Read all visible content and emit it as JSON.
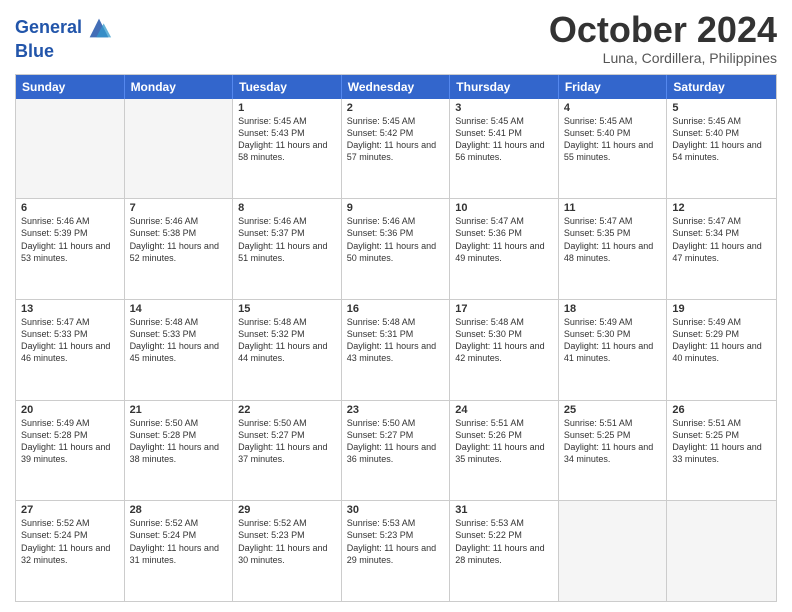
{
  "header": {
    "logo_line1": "General",
    "logo_line2": "Blue",
    "month": "October 2024",
    "location": "Luna, Cordillera, Philippines"
  },
  "days_of_week": [
    "Sunday",
    "Monday",
    "Tuesday",
    "Wednesday",
    "Thursday",
    "Friday",
    "Saturday"
  ],
  "weeks": [
    [
      {
        "day": "",
        "empty": true
      },
      {
        "day": "",
        "empty": true
      },
      {
        "day": "1",
        "sunrise": "5:45 AM",
        "sunset": "5:43 PM",
        "daylight": "11 hours and 58 minutes."
      },
      {
        "day": "2",
        "sunrise": "5:45 AM",
        "sunset": "5:42 PM",
        "daylight": "11 hours and 57 minutes."
      },
      {
        "day": "3",
        "sunrise": "5:45 AM",
        "sunset": "5:41 PM",
        "daylight": "11 hours and 56 minutes."
      },
      {
        "day": "4",
        "sunrise": "5:45 AM",
        "sunset": "5:40 PM",
        "daylight": "11 hours and 55 minutes."
      },
      {
        "day": "5",
        "sunrise": "5:45 AM",
        "sunset": "5:40 PM",
        "daylight": "11 hours and 54 minutes."
      }
    ],
    [
      {
        "day": "6",
        "sunrise": "5:46 AM",
        "sunset": "5:39 PM",
        "daylight": "11 hours and 53 minutes."
      },
      {
        "day": "7",
        "sunrise": "5:46 AM",
        "sunset": "5:38 PM",
        "daylight": "11 hours and 52 minutes."
      },
      {
        "day": "8",
        "sunrise": "5:46 AM",
        "sunset": "5:37 PM",
        "daylight": "11 hours and 51 minutes."
      },
      {
        "day": "9",
        "sunrise": "5:46 AM",
        "sunset": "5:36 PM",
        "daylight": "11 hours and 50 minutes."
      },
      {
        "day": "10",
        "sunrise": "5:47 AM",
        "sunset": "5:36 PM",
        "daylight": "11 hours and 49 minutes."
      },
      {
        "day": "11",
        "sunrise": "5:47 AM",
        "sunset": "5:35 PM",
        "daylight": "11 hours and 48 minutes."
      },
      {
        "day": "12",
        "sunrise": "5:47 AM",
        "sunset": "5:34 PM",
        "daylight": "11 hours and 47 minutes."
      }
    ],
    [
      {
        "day": "13",
        "sunrise": "5:47 AM",
        "sunset": "5:33 PM",
        "daylight": "11 hours and 46 minutes."
      },
      {
        "day": "14",
        "sunrise": "5:48 AM",
        "sunset": "5:33 PM",
        "daylight": "11 hours and 45 minutes."
      },
      {
        "day": "15",
        "sunrise": "5:48 AM",
        "sunset": "5:32 PM",
        "daylight": "11 hours and 44 minutes."
      },
      {
        "day": "16",
        "sunrise": "5:48 AM",
        "sunset": "5:31 PM",
        "daylight": "11 hours and 43 minutes."
      },
      {
        "day": "17",
        "sunrise": "5:48 AM",
        "sunset": "5:30 PM",
        "daylight": "11 hours and 42 minutes."
      },
      {
        "day": "18",
        "sunrise": "5:49 AM",
        "sunset": "5:30 PM",
        "daylight": "11 hours and 41 minutes."
      },
      {
        "day": "19",
        "sunrise": "5:49 AM",
        "sunset": "5:29 PM",
        "daylight": "11 hours and 40 minutes."
      }
    ],
    [
      {
        "day": "20",
        "sunrise": "5:49 AM",
        "sunset": "5:28 PM",
        "daylight": "11 hours and 39 minutes."
      },
      {
        "day": "21",
        "sunrise": "5:50 AM",
        "sunset": "5:28 PM",
        "daylight": "11 hours and 38 minutes."
      },
      {
        "day": "22",
        "sunrise": "5:50 AM",
        "sunset": "5:27 PM",
        "daylight": "11 hours and 37 minutes."
      },
      {
        "day": "23",
        "sunrise": "5:50 AM",
        "sunset": "5:27 PM",
        "daylight": "11 hours and 36 minutes."
      },
      {
        "day": "24",
        "sunrise": "5:51 AM",
        "sunset": "5:26 PM",
        "daylight": "11 hours and 35 minutes."
      },
      {
        "day": "25",
        "sunrise": "5:51 AM",
        "sunset": "5:25 PM",
        "daylight": "11 hours and 34 minutes."
      },
      {
        "day": "26",
        "sunrise": "5:51 AM",
        "sunset": "5:25 PM",
        "daylight": "11 hours and 33 minutes."
      }
    ],
    [
      {
        "day": "27",
        "sunrise": "5:52 AM",
        "sunset": "5:24 PM",
        "daylight": "11 hours and 32 minutes."
      },
      {
        "day": "28",
        "sunrise": "5:52 AM",
        "sunset": "5:24 PM",
        "daylight": "11 hours and 31 minutes."
      },
      {
        "day": "29",
        "sunrise": "5:52 AM",
        "sunset": "5:23 PM",
        "daylight": "11 hours and 30 minutes."
      },
      {
        "day": "30",
        "sunrise": "5:53 AM",
        "sunset": "5:23 PM",
        "daylight": "11 hours and 29 minutes."
      },
      {
        "day": "31",
        "sunrise": "5:53 AM",
        "sunset": "5:22 PM",
        "daylight": "11 hours and 28 minutes."
      },
      {
        "day": "",
        "empty": true
      },
      {
        "day": "",
        "empty": true
      }
    ]
  ]
}
